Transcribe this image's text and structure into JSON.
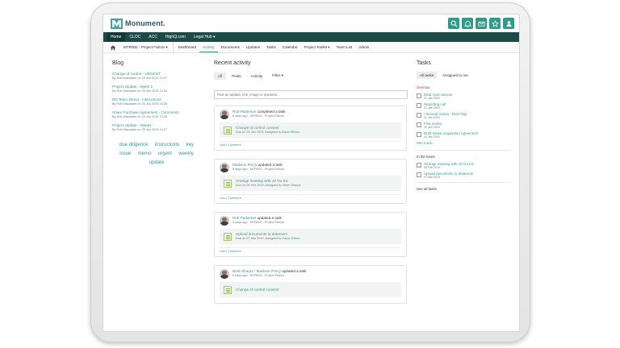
{
  "header": {
    "logo_text": "Monument."
  },
  "mainnav": [
    {
      "label": "Home",
      "active": true
    },
    {
      "label": "CLOC"
    },
    {
      "label": "ACC"
    },
    {
      "label": "HighQ.com"
    },
    {
      "label": "Legal Hub ▾"
    }
  ],
  "subnav": {
    "project": "MTR002 - Project Falcon ▾",
    "items": [
      "Dashboard",
      "Activity",
      "Documents",
      "Updates",
      "Tasks",
      "Calendar",
      "Project Toolkit ▾",
      "Team List",
      "Admin"
    ],
    "active": "Activity"
  },
  "blog": {
    "title": "Blog",
    "items": [
      {
        "title": "Change of control - URGENT",
        "meta": "By Rob Macadam on 25 Jan 2019 13:37"
      },
      {
        "title": "Project Update - Week 2",
        "meta": "By Rob Macadam on 25 Jan 2019 13:30"
      },
      {
        "title": "DD Team Memo - Instructions",
        "meta": "By Rob Macadam on 25 Jan 2019 13:28"
      },
      {
        "title": "Share Purchase Agreement - Comments",
        "meta": "By Rob Macadam on 25 Jan 2019 13:30"
      },
      {
        "title": "Project Update - Week1",
        "meta": "By Rob Macadam on 25 Jan 2019 13:27"
      }
    ],
    "tags": [
      "due diligence",
      "instructions",
      "key",
      "issue",
      "memo",
      "urgent",
      "weekly",
      "update"
    ]
  },
  "activity": {
    "title": "Recent activity",
    "filters": [
      "All",
      "Posts",
      "Activity",
      "Filter ▾"
    ],
    "post_placeholder": "Post an update, link, image or question...",
    "cards": [
      {
        "actor": "Rob Patterson",
        "action": " completed a task",
        "when": "6 days ago · MTR002 - Project Falcon",
        "task": "Change of control consent",
        "due": "Due on 24 Jan 2019, Assigned to ",
        "assignee": "David Wilson",
        "foot": "Like | Comment"
      },
      {
        "actor": "Madison Percy",
        "action": " updated a task",
        "when": "6 days ago · MTR002 - Project Falcon",
        "task": "Arrange meeting with JV Go Inc",
        "due": "Due on 08 Feb 2019, Assigned to ",
        "assignee": "Helen Sharpe",
        "foot": "Like | Comment"
      },
      {
        "actor": "Rob Patterson",
        "action": " updated a task",
        "when": "6 days ago · MTR002 - Project Falcon",
        "task": "Upload documents to dataroom",
        "due": "Due on 07 Mar 2019, Assigned to ",
        "assignee": "David Wilson",
        "foot": "Like | Comment"
      },
      {
        "actor": "Brett Sharpe ! ",
        "actor2": "Madison Percy",
        "action": " updated a task",
        "when": "6 days ago · MTR002 - Project Falcon",
        "task": "Change of control consent",
        "due": "",
        "assignee": "",
        "foot": ""
      }
    ]
  },
  "tasks": {
    "title": "Tasks",
    "tabs": [
      "All tasks",
      "Assigned to me"
    ],
    "overdue_label": "Overdue",
    "overdue": [
      {
        "title": "Data room access",
        "date": "31 Jan 2019"
      },
      {
        "title": "Reporting call",
        "date": "31 Jan 2019"
      },
      {
        "title": "Second review - Red Flag",
        "date": "31 Jan 2019",
        "flag": "! "
      },
      {
        "title": "First review",
        "date": "31 Jan 2019"
      },
      {
        "title": "Draft Share Acquisition Agreement",
        "date": "31 Jan 2019"
      }
    ],
    "see_more": "See more...",
    "future_label": "In the future",
    "future": [
      {
        "title": "Arrange meeting with JV Go Inc",
        "date": "08 Feb 2019"
      },
      {
        "title": "Upload documents to dataroom",
        "date": "07 Mar 2019"
      }
    ],
    "see_all": "See all tasks"
  }
}
